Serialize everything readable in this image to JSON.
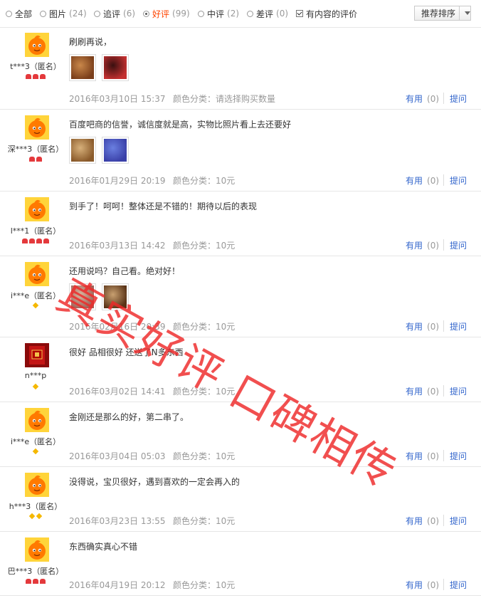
{
  "filters": [
    {
      "label": "全部",
      "count": "",
      "checked": false
    },
    {
      "label": "图片",
      "count": "(24)",
      "checked": false
    },
    {
      "label": "追评",
      "count": "(6)",
      "checked": false
    },
    {
      "label": "好评",
      "count": "(99)",
      "checked": true
    },
    {
      "label": "中评",
      "count": "(2)",
      "checked": false
    },
    {
      "label": "差评",
      "count": "(0)",
      "checked": false
    }
  ],
  "has_content_label": "有内容的评价",
  "sort_label": "推荐排序",
  "useful_label": "有用",
  "ask_label": "提问",
  "reviews": [
    {
      "user": "t***3（匿名）",
      "content": "刷刷再说，",
      "date": "2016年03月10日 15:37",
      "sku": "颜色分类：请选择购买数量",
      "useful": "(0)",
      "rank": "hearts",
      "rank_count": 3,
      "photos": 2
    },
    {
      "user": "深***3（匿名）",
      "content": "百度吧商的信誉，诚信度就是高，实物比照片看上去还要好",
      "date": "2016年01月29日 20:19",
      "sku": "颜色分类：10元",
      "useful": "(0)",
      "rank": "hearts",
      "rank_count": 2,
      "photos": 2
    },
    {
      "user": "l***1（匿名）",
      "content": "到手了！呵呵！整体还是不错的！期待以后的表现",
      "date": "2016年03月13日 14:42",
      "sku": "颜色分类：10元",
      "useful": "(0)",
      "rank": "hearts",
      "rank_count": 4,
      "photos": 0
    },
    {
      "user": "i***e（匿名）",
      "content": "还用说吗？自己看。绝对好！",
      "date": "2016年02月16日 20:39",
      "sku": "颜色分类：10元",
      "useful": "(0)",
      "rank": "diamond",
      "rank_count": 1,
      "photos": 2
    },
    {
      "user": "n***p",
      "content": "很好 品相很好 还送了N多东西",
      "date": "2016年03月02日 14:41",
      "sku": "颜色分类：10元",
      "useful": "(0)",
      "rank": "diamond",
      "rank_count": 1,
      "photos": 0
    },
    {
      "user": "i***e（匿名）",
      "content": "金刚还是那么的好，第二串了。",
      "date": "2016年03月04日 05:03",
      "sku": "颜色分类：10元",
      "useful": "(0)",
      "rank": "diamond",
      "rank_count": 1,
      "photos": 0
    },
    {
      "user": "h***3（匿名）",
      "content": "没得说，宝贝很好，遇到喜欢的一定会再入的",
      "date": "2016年03月23日 13:55",
      "sku": "颜色分类：10元",
      "useful": "(0)",
      "rank": "diamond",
      "rank_count": 2,
      "photos": 0
    },
    {
      "user": "巴***3（匿名）",
      "content": "东西确实真心不错",
      "date": "2016年04月19日 20:12",
      "sku": "颜色分类：10元",
      "useful": "(0)",
      "rank": "hearts",
      "rank_count": 3,
      "photos": 0
    }
  ],
  "watermark": "真实好评 口碑相传",
  "colors": {
    "accent": "#ff4400",
    "link": "#3366cc",
    "muted": "#999999",
    "watermark": "#ee2828",
    "avatar": "#ff7a00"
  }
}
